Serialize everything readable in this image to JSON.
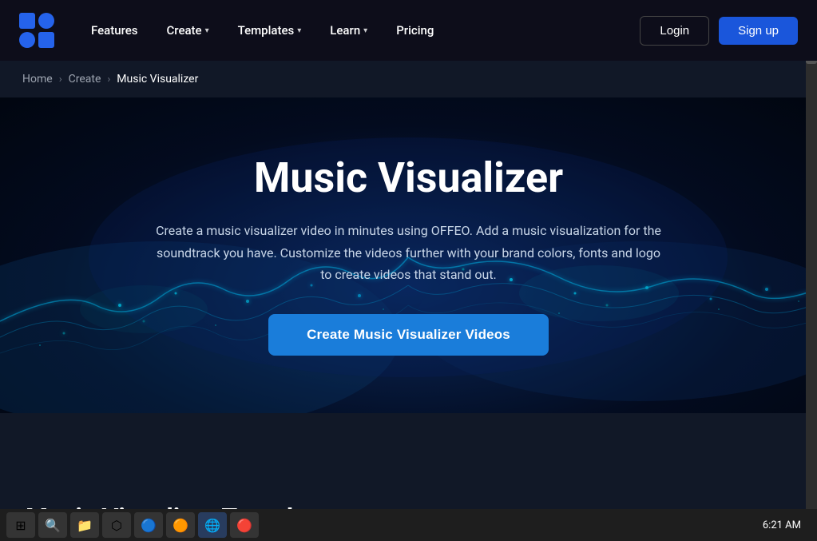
{
  "brand": {
    "name": "OFFEO",
    "logo_alt": "OFFEO logo"
  },
  "nav": {
    "features_label": "Features",
    "create_label": "Create",
    "templates_label": "Templates",
    "learn_label": "Learn",
    "pricing_label": "Pricing",
    "login_label": "Login",
    "signup_label": "Sign up"
  },
  "breadcrumb": {
    "home": "Home",
    "create": "Create",
    "current": "Music Visualizer"
  },
  "hero": {
    "title": "Music Visualizer",
    "subtitle": "Create a music visualizer video in minutes using OFFEO. Add a music visualization for the soundtrack you have. Customize the videos further with your brand colors, fonts and logo to create videos that stand out.",
    "cta_label": "Create Music Visualizer Videos"
  },
  "below_section": {
    "title": "Music Visualizer Templates"
  },
  "taskbar": {
    "time": "6:21 AM"
  }
}
